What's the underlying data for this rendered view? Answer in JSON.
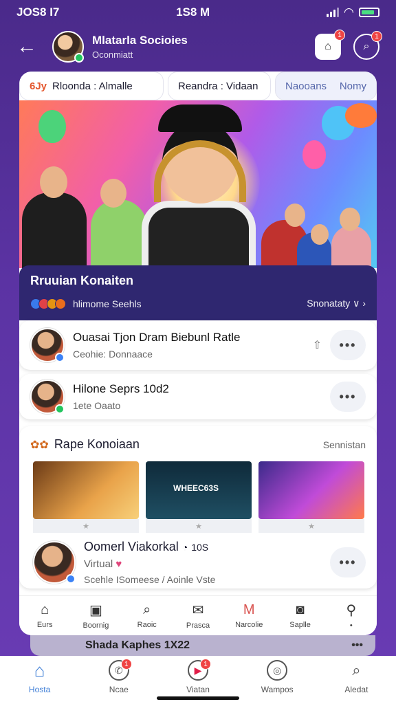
{
  "status": {
    "time": "JOS8 I7",
    "center": "1S8 M"
  },
  "header": {
    "title": "Mlatarla Socioies",
    "subtitle": "Oconmiatt",
    "notif_badge": "1",
    "search_badge": "1"
  },
  "tabs": [
    {
      "icon": "6Jy",
      "label": "Rloonda : Almalle"
    },
    {
      "label": "Reandra : Vidaan"
    },
    {
      "label": "Naooans",
      "extra": "Nomy"
    }
  ],
  "live": {
    "title": "Rruuian Konaiten",
    "meta": "hlimome Seehls",
    "right": "Snonataty"
  },
  "rows": [
    {
      "title": "Ouasai Tjon Dram Biebunl Ratle",
      "sub": "Ceohie: Donnaace"
    },
    {
      "title": "Hilone Seprs 10d2",
      "sub": "1ete   Oaato"
    }
  ],
  "section": {
    "title": "Rape Konoiaan",
    "right": "Sennistan",
    "thumb_text": "WHEEC63S",
    "feature_title": "Oomerl Viakorkal",
    "feature_num": "10S",
    "feature_line2": "Virtual",
    "feature_line3": "Scehle ISomeese / Aoinle Vste"
  },
  "inner_nav": [
    "Eurs",
    "Boornig",
    "Raoic",
    "Prasca",
    "Narcolie",
    "Saplle",
    ""
  ],
  "peek": "Shada Kaphes 1X22",
  "bottom_nav": [
    {
      "label": "Hosta",
      "badge": ""
    },
    {
      "label": "Ncae",
      "badge": "1"
    },
    {
      "label": "Viatan",
      "badge": "1"
    },
    {
      "label": "Wampos",
      "badge": ""
    },
    {
      "label": "Aledat",
      "badge": ""
    }
  ]
}
